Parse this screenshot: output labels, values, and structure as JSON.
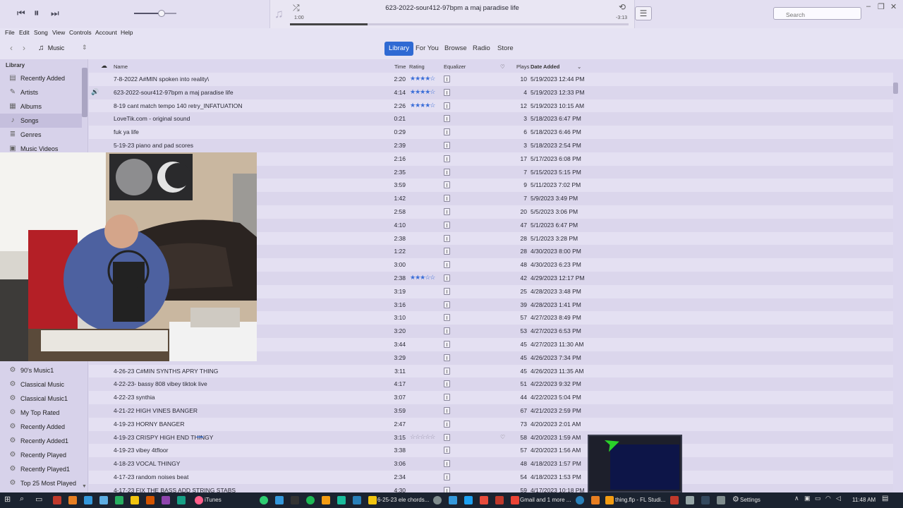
{
  "player": {
    "prev_icon": "⏮",
    "pause_icon": "⏸",
    "next_icon": "⏭",
    "volume_level": 0.65,
    "now_playing": "623-2022-sour412-97bpm a maj paradise life",
    "elapsed": "1:00",
    "remaining": "-3:13",
    "progress": 0.23,
    "shuffle_icon": "⤮",
    "repeat_icon": "⟲",
    "list_icon": "☰",
    "search_placeholder": "Search"
  },
  "menubar": [
    "File",
    "Edit",
    "Song",
    "View",
    "Controls",
    "Account",
    "Help"
  ],
  "nav": {
    "media": "Music",
    "tabs": [
      "Library",
      "For You",
      "Browse",
      "Radio",
      "Store"
    ],
    "active_tab": "Library"
  },
  "sidebar": {
    "header": "Library",
    "library_items": [
      {
        "label": "Recently Added",
        "icon": "▤"
      },
      {
        "label": "Artists",
        "icon": "🎤"
      },
      {
        "label": "Albums",
        "icon": "▦"
      },
      {
        "label": "Songs",
        "icon": "♪"
      },
      {
        "label": "Genres",
        "icon": "≣"
      },
      {
        "label": "Music Videos",
        "icon": "▣"
      }
    ],
    "playlists": [
      "90's Music1",
      "Classical Music",
      "Classical Music1",
      "My Top Rated",
      "Recently Added",
      "Recently Added1",
      "Recently Played",
      "Recently Played1",
      "Top 25 Most Played"
    ]
  },
  "columns": {
    "name": "Name",
    "time": "Time",
    "rating": "Rating",
    "equalizer": "Equalizer",
    "plays": "Plays",
    "date_added": "Date Added"
  },
  "songs": [
    {
      "name": "7-8-2022 A#MIN spoken into reality\\",
      "time": "2:20",
      "rating": 4,
      "plays": "10",
      "date": "5/19/2023 12:44 PM"
    },
    {
      "name": "623-2022-sour412-97bpm a maj paradise life",
      "time": "4:14",
      "rating": 4,
      "plays": "4",
      "date": "5/19/2023 12:33 PM",
      "playing": true
    },
    {
      "name": "8-19 cant match tempo 140 retry_INFATUATION",
      "time": "2:26",
      "rating": 4,
      "plays": "12",
      "date": "5/19/2023 10:15 AM"
    },
    {
      "name": "LoveTik.com - original sound",
      "time": "0:21",
      "rating": 0,
      "plays": "3",
      "date": "5/18/2023 6:47 PM"
    },
    {
      "name": "fuk ya life",
      "time": "0:29",
      "rating": 0,
      "plays": "6",
      "date": "5/18/2023 6:46 PM"
    },
    {
      "name": "5-19-23 piano and pad scores",
      "time": "2:39",
      "rating": 0,
      "plays": "3",
      "date": "5/18/2023 2:54 PM"
    },
    {
      "name": "",
      "time": "2:16",
      "rating": 0,
      "plays": "17",
      "date": "5/17/2023 6:08 PM"
    },
    {
      "name": "",
      "time": "2:35",
      "rating": 0,
      "plays": "7",
      "date": "5/15/2023 5:15 PM"
    },
    {
      "name": "",
      "time": "3:59",
      "rating": 0,
      "plays": "9",
      "date": "5/11/2023 7:02 PM"
    },
    {
      "name": "",
      "time": "1:42",
      "rating": 0,
      "plays": "7",
      "date": "5/9/2023 3:49 PM"
    },
    {
      "name": "",
      "time": "2:58",
      "rating": 0,
      "plays": "20",
      "date": "5/5/2023 3:06 PM"
    },
    {
      "name": "",
      "time": "4:10",
      "rating": 0,
      "plays": "47",
      "date": "5/1/2023 6:47 PM"
    },
    {
      "name": "",
      "time": "2:38",
      "rating": 0,
      "plays": "28",
      "date": "5/1/2023 3:28 PM"
    },
    {
      "name": "",
      "time": "1:22",
      "rating": 0,
      "plays": "28",
      "date": "4/30/2023 8:00 PM"
    },
    {
      "name": "",
      "time": "3:00",
      "rating": 0,
      "plays": "48",
      "date": "4/30/2023 6:23 PM"
    },
    {
      "name": "",
      "time": "2:38",
      "rating": 3,
      "plays": "42",
      "date": "4/29/2023 12:17 PM"
    },
    {
      "name": "",
      "time": "3:19",
      "rating": 0,
      "plays": "25",
      "date": "4/28/2023 3:48 PM"
    },
    {
      "name": "",
      "time": "3:16",
      "rating": 0,
      "plays": "39",
      "date": "4/28/2023 1:41 PM"
    },
    {
      "name": "",
      "time": "3:10",
      "rating": 0,
      "plays": "57",
      "date": "4/27/2023 8:49 PM"
    },
    {
      "name": "",
      "time": "3:20",
      "rating": 0,
      "plays": "53",
      "date": "4/27/2023 6:53 PM"
    },
    {
      "name": "",
      "time": "3:44",
      "rating": 0,
      "plays": "45",
      "date": "4/27/2023 11:30 AM"
    },
    {
      "name": "",
      "time": "3:29",
      "rating": 0,
      "plays": "45",
      "date": "4/26/2023 7:34 PM"
    },
    {
      "name": "4-26-23 C#MIN SYNTHS APRY THING",
      "time": "3:11",
      "rating": 0,
      "plays": "45",
      "date": "4/26/2023 11:35 AM"
    },
    {
      "name": "4-22-23- bassy 808 vibey tiktok live",
      "time": "4:17",
      "rating": 0,
      "plays": "51",
      "date": "4/22/2023 9:32 PM"
    },
    {
      "name": "4-22-23 synthia",
      "time": "3:07",
      "rating": 0,
      "plays": "44",
      "date": "4/22/2023 5:04 PM"
    },
    {
      "name": "4-21-22 HIGH VINES BANGER",
      "time": "3:59",
      "rating": 0,
      "plays": "67",
      "date": "4/21/2023 2:59 PM"
    },
    {
      "name": "4-19-23  HORNY BANGER",
      "time": "2:47",
      "rating": 0,
      "plays": "73",
      "date": "4/20/2023 2:01 AM"
    },
    {
      "name": "4-19-23 CRISPY HIGH END THINGY",
      "time": "3:15",
      "rating": -1,
      "plays": "58",
      "date": "4/20/2023 1:59 AM",
      "more": "•••",
      "heart": true
    },
    {
      "name": "4-19-23 vibey 4tfloor",
      "time": "3:38",
      "rating": 0,
      "plays": "57",
      "date": "4/20/2023 1:56 AM"
    },
    {
      "name": "4-18-23 VOCAL THINGY",
      "time": "3:06",
      "rating": 0,
      "plays": "48",
      "date": "4/18/2023 1:57 PM"
    },
    {
      "name": "4-17-23 random noises beat",
      "time": "2:34",
      "rating": 0,
      "plays": "54",
      "date": "4/18/2023 1:53 PM"
    },
    {
      "name": "4-17-23 FIX THE BASS ADD STRING STABS",
      "time": "4:30",
      "rating": 0,
      "plays": "59",
      "date": "4/17/2023 10:18 PM"
    }
  ],
  "taskbar": {
    "itunes": "iTunes",
    "chrome_tab": "6-25-23 ele chords...",
    "gmail": "Gmail and 1 more ...",
    "fl": "thing.flp - FL Studi...",
    "settings": "Settings",
    "clock": "11:48 AM"
  },
  "colors": {
    "accent": "#2f6ad3",
    "background": "#dcd7ee",
    "taskbar": "#1b2330"
  }
}
